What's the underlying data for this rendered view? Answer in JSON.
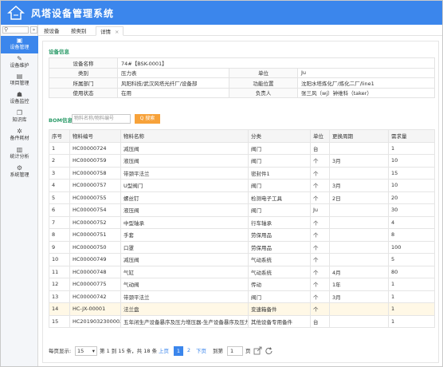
{
  "app": {
    "title": "风塔设备管理系统"
  },
  "sidebar": {
    "collapse_glyph": "»",
    "items": [
      {
        "label": "设备管理",
        "icon": "dashboard-icon",
        "glyph": "▣"
      },
      {
        "label": "设备维护",
        "icon": "wrench-icon",
        "glyph": "✎"
      },
      {
        "label": "项目管理",
        "icon": "folder-icon",
        "glyph": "▤"
      },
      {
        "label": "设备监控",
        "icon": "people-icon",
        "glyph": "☗"
      },
      {
        "label": "知识库",
        "icon": "book-icon",
        "glyph": "❐"
      },
      {
        "label": "备件耗材",
        "icon": "gear-icon",
        "glyph": "✲"
      },
      {
        "label": "统计分析",
        "icon": "chart-icon",
        "glyph": "▥"
      },
      {
        "label": "系统管理",
        "icon": "settings-icon",
        "glyph": "⚙"
      }
    ]
  },
  "tabs": [
    {
      "label": "按设备"
    },
    {
      "label": "按类别"
    },
    {
      "label": "详情",
      "close": "×"
    }
  ],
  "device_info": {
    "section_title": "设备信息",
    "rows": [
      {
        "k1": "设备名称",
        "v1": "74#【BSK-0001】"
      },
      {
        "k1": "类别",
        "v1": "压力表",
        "k2": "单位",
        "v2": "Ju"
      },
      {
        "k1": "所属部门",
        "v1": "风阳科技/武汉风塔光纤厂/设备部",
        "k2": "功能位置",
        "v2": "沈阳水塔炼化厂/炼化二厂/line1"
      },
      {
        "k1": "使用状态",
        "v1": "在用",
        "k2": "负责人",
        "v2": "张三风（wj）钟维科（taker）"
      }
    ]
  },
  "bom": {
    "label": "BOM信息",
    "search_placeholder": "物料名称/物料编号",
    "search_button": "Q 搜索",
    "columns": [
      "序号",
      "物料编号",
      "物料名称",
      "分类",
      "单位",
      "更换周期",
      "需求量"
    ],
    "rows": [
      [
        "1",
        "HC00000724",
        "减压阀",
        "阀门",
        "台",
        "",
        "1"
      ],
      [
        "2",
        "HC00000759",
        "液压阀",
        "阀门",
        "个",
        "3月",
        "10"
      ],
      [
        "3",
        "HC00000758",
        "带颈平法兰",
        "密封件1",
        "个",
        "",
        "15"
      ],
      [
        "4",
        "HC00000757",
        "U型阀门",
        "阀门",
        "个",
        "3月",
        "10"
      ],
      [
        "5",
        "HC00000755",
        "螺丝钉",
        "检测电子工具",
        "个",
        "2日",
        "20"
      ],
      [
        "6",
        "HC00000754",
        "液压阀",
        "阀门",
        "Ju",
        "",
        "30"
      ],
      [
        "7",
        "HC00000752",
        "中型轴承",
        "行车轴承",
        "个",
        "",
        "4"
      ],
      [
        "8",
        "HC00000751",
        "手套",
        "劳保用品",
        "个",
        "",
        "8"
      ],
      [
        "9",
        "HC00000750",
        "口罩",
        "劳保用品",
        "个",
        "",
        "100"
      ],
      [
        "10",
        "HC00000749",
        "减压阀",
        "气动系统",
        "个",
        "",
        "5"
      ],
      [
        "11",
        "HC00000748",
        "气缸",
        "气动系统",
        "个",
        "4月",
        "80"
      ],
      [
        "12",
        "HC00000775",
        "气动阀",
        "传动",
        "个",
        "1年",
        "1"
      ],
      [
        "13",
        "HC00000742",
        "带颈平法兰",
        "阀门",
        "个",
        "3月",
        "1"
      ],
      [
        "14",
        "HC-JX-00001",
        "法兰盘",
        "变速箱备件",
        "个",
        "",
        "1"
      ],
      [
        "15",
        "HC2019032300002",
        "五年闭生产设备暴序及压力增压器-生产设备暴序及压力增压器",
        "其他设备专用备件",
        "台",
        "",
        "1"
      ]
    ]
  },
  "pager": {
    "per_page_label": "每页显示:",
    "per_page_value": "15",
    "summary": "第 1 到 15 条，共 18 条",
    "prev": "上页",
    "page1": "1",
    "page2": "2",
    "next": "下页",
    "goto_label": "到第",
    "goto_value": "1",
    "page_unit": "页"
  },
  "colors": {
    "primary": "#3b86ec",
    "accent_green": "#2d9c6a",
    "search_orange": "#f7a23a"
  }
}
